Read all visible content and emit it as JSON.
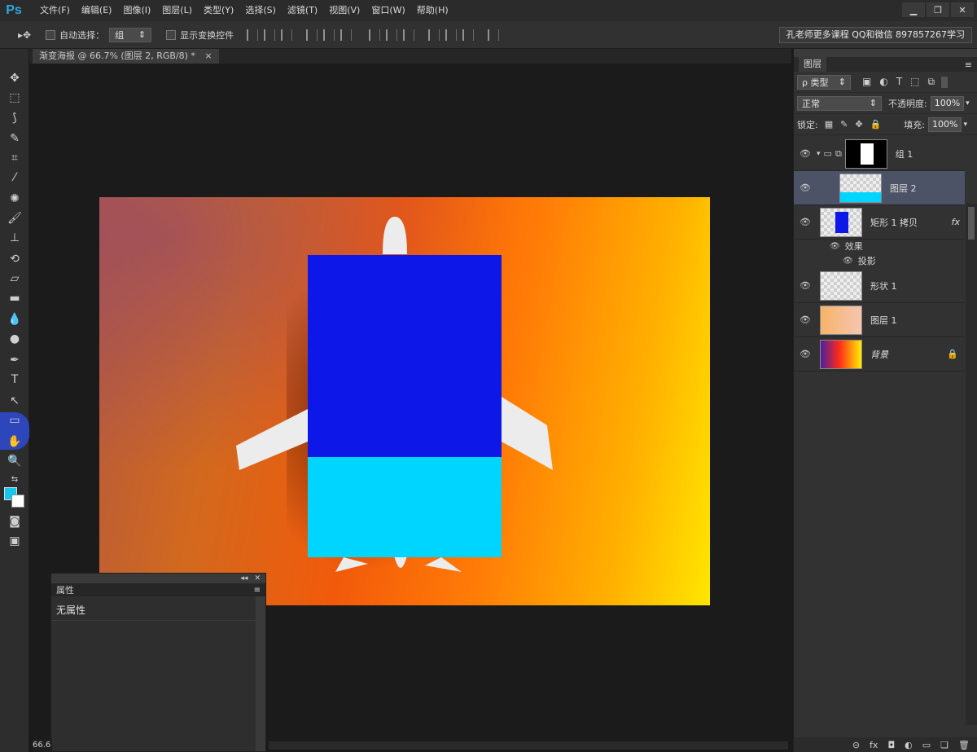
{
  "app": {
    "logo": "Ps"
  },
  "menu": [
    "文件(F)",
    "编辑(E)",
    "图像(I)",
    "图层(L)",
    "类型(Y)",
    "选择(S)",
    "滤镜(T)",
    "视图(V)",
    "窗口(W)",
    "帮助(H)"
  ],
  "window_controls": [
    "▁",
    "❐",
    "✕"
  ],
  "options": {
    "auto_select_label": "自动选择：",
    "auto_select_value": "组",
    "show_transform_label": "显示变换控件",
    "course_text": "孔老师更多课程 QQ和微信 897857267学习"
  },
  "document": {
    "tab_title": "渐变海报 @ 66.7% (图层 2, RGB/8) *",
    "tab_close": "×",
    "zoom": "66.6"
  },
  "properties_panel": {
    "title": "属性",
    "body": "无属性"
  },
  "layers_panel": {
    "tab": "图层",
    "filter_label": "ρ 类型",
    "blend_mode": "正常",
    "opacity_label": "不透明度:",
    "opacity_value": "100%",
    "lock_label": "锁定:",
    "fill_label": "填充:",
    "fill_value": "100%",
    "layers": [
      {
        "name": "组 1"
      },
      {
        "name": "图层 2"
      },
      {
        "name": "矩形 1 拷贝",
        "fx": "fx"
      },
      {
        "name": "形状 1"
      },
      {
        "name": "图层 1"
      },
      {
        "name": "背景"
      }
    ],
    "effects_label": "效果",
    "shadow_label": "投影"
  },
  "colors": {
    "foreground": "#12c8f0",
    "background": "#ffffff",
    "rect_top": "#0c17e8",
    "rect_bottom": "#00d5ff"
  }
}
